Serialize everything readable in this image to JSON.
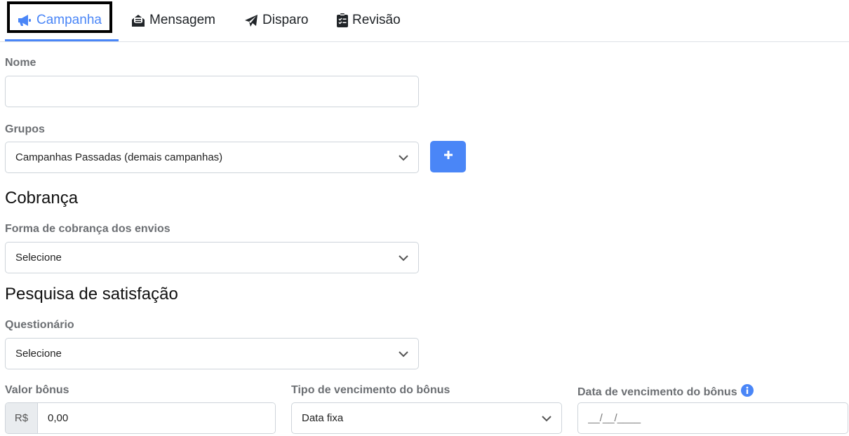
{
  "tabs": [
    {
      "label": "Campanha",
      "icon": "megaphone-icon",
      "active": true
    },
    {
      "label": "Mensagem",
      "icon": "envelope-open-icon"
    },
    {
      "label": "Disparo",
      "icon": "paper-plane-icon"
    },
    {
      "label": "Revisão",
      "icon": "clipboard-check-icon"
    }
  ],
  "form": {
    "nome_label": "Nome",
    "nome_value": "",
    "grupos_label": "Grupos",
    "grupos_selected": "Campanhas Passadas (demais campanhas)",
    "add_group_icon": "plus-icon",
    "cobranca_title": "Cobrança",
    "forma_label": "Forma de cobrança dos envios",
    "forma_selected": "Selecione",
    "pesquisa_title": "Pesquisa de satisfação",
    "questionario_label": "Questionário",
    "questionario_selected": "Selecione",
    "valor_label": "Valor bônus",
    "valor_prefix": "R$",
    "valor_value": "0,00",
    "tipo_label": "Tipo de vencimento do bônus",
    "tipo_selected": "Data fixa",
    "data_label": "Data de vencimento do bônus",
    "data_placeholder": "__/__/____"
  },
  "colors": {
    "accent": "#4a86f7",
    "label": "#6c6f73",
    "border": "#ced4da"
  }
}
